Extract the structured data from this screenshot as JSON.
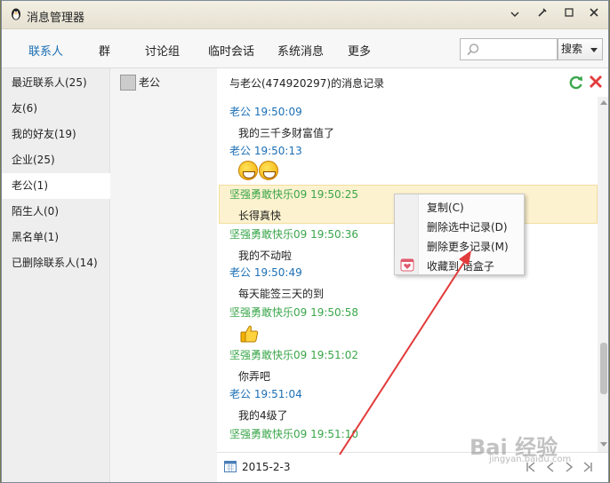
{
  "window": {
    "title": "消息管理器",
    "icon": "qq-penguin-icon",
    "buttons": [
      "chevron-down-icon",
      "skin-icon",
      "minimize-icon",
      "close-icon"
    ]
  },
  "tabs": [
    {
      "label": "联系人",
      "active": true
    },
    {
      "label": "群"
    },
    {
      "label": "讨论组"
    },
    {
      "label": "临时会话"
    },
    {
      "label": "系统消息"
    },
    {
      "label": "更多"
    }
  ],
  "search": {
    "placeholder": "",
    "button_label": "搜索"
  },
  "sidebar": {
    "items": [
      {
        "label": "最近联系人(25)"
      },
      {
        "label": "友(6)"
      },
      {
        "label": "我的好友(19)"
      },
      {
        "label": "企业(25)"
      },
      {
        "label": "老公(1)",
        "active": true
      },
      {
        "label": "陌生人(0)"
      },
      {
        "label": "黑名单(1)"
      },
      {
        "label": "已删除联系人(14)"
      }
    ]
  },
  "contacts": [
    {
      "name": "老公"
    }
  ],
  "chat": {
    "title": "与老公(474920297)的消息记录",
    "messages": [
      {
        "sender": "老公",
        "time": "19:50:09",
        "header": "老公 19:50:09",
        "text": "我的三千多财富值了",
        "side": "other"
      },
      {
        "sender": "老公",
        "time": "19:50:13",
        "header": "老公 19:50:13",
        "text": "",
        "emoji": "grin-emoji x2",
        "side": "other"
      },
      {
        "sender": "坚强勇敢快乐09",
        "time": "19:50:25",
        "header": "坚强勇敢快乐09 19:50:25",
        "text": "长得真快",
        "side": "mine",
        "selected": true
      },
      {
        "sender": "坚强勇敢快乐09",
        "time": "19:50:36",
        "header": "坚强勇敢快乐09 19:50:36",
        "text": "我的不动啦",
        "side": "mine"
      },
      {
        "sender": "老公",
        "time": "19:50:49",
        "header": "老公 19:50:49",
        "text": "每天能签三天的到",
        "side": "other"
      },
      {
        "sender": "坚强勇敢快乐09",
        "time": "19:50:58",
        "header": "坚强勇敢快乐09 19:50:58",
        "text": "",
        "emoji": "thumbs-up-emoji",
        "side": "mine"
      },
      {
        "sender": "坚强勇敢快乐09",
        "time": "19:51:02",
        "header": "坚强勇敢快乐09 19:51:02",
        "text": "你弄吧",
        "side": "mine"
      },
      {
        "sender": "老公",
        "time": "19:51:04",
        "header": "老公 19:51:04",
        "text": "我的4级了",
        "side": "other"
      },
      {
        "sender": "坚强勇敢快乐09",
        "time": "19:51:10",
        "header": "坚强勇敢快乐09 19:51:10",
        "text": "",
        "side": "mine"
      }
    ]
  },
  "context_menu": {
    "items": [
      {
        "label": "复制(C)"
      },
      {
        "label": "删除选中记录(D)"
      },
      {
        "label": "删除更多记录(M)"
      },
      {
        "label": "收藏到  语盒子",
        "icon": "heart-box-icon"
      }
    ]
  },
  "bottom": {
    "date": "2015-2-3",
    "pager_icons": [
      "first-page-icon",
      "prev-page-icon",
      "next-page-icon",
      "last-page-icon"
    ]
  },
  "watermark": {
    "text": "Bai 经验",
    "sub": "jingyan.baidu.com"
  },
  "colors": {
    "accent": "#1b6fb5",
    "mine": "#3aa64a",
    "highlight": "#fdf2cf",
    "annotation": "#e23b3b"
  }
}
